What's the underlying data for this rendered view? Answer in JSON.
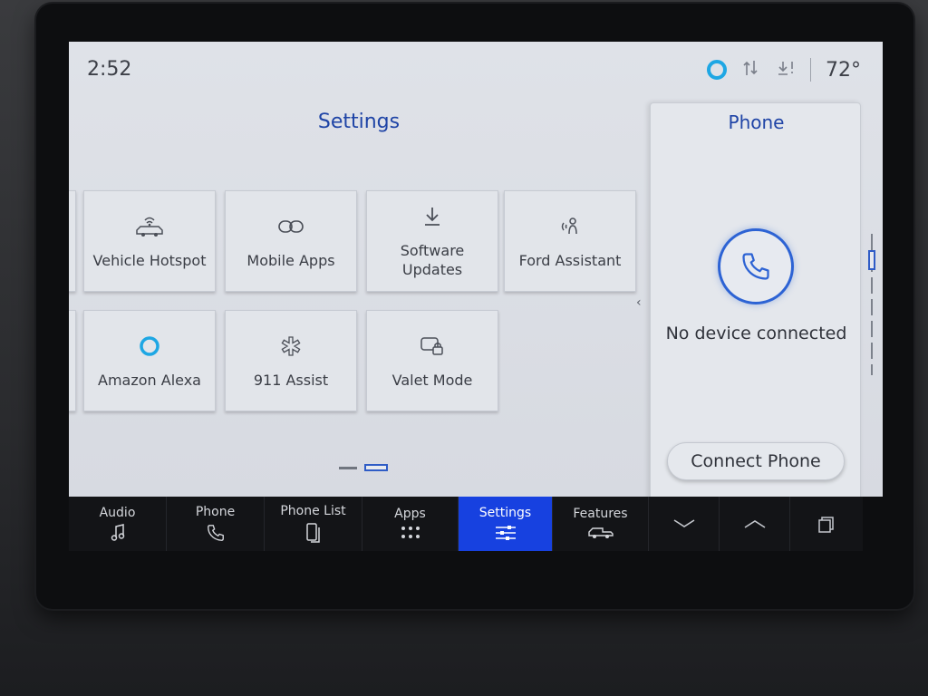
{
  "status": {
    "time": "2:52",
    "temperature": "72°",
    "alexa_color": "#1ea7e4"
  },
  "settings": {
    "title": "Settings",
    "tiles": [
      {
        "label": "Vehicle Hotspot",
        "icon": "car-wifi-icon"
      },
      {
        "label": "Mobile Apps",
        "icon": "link-icon"
      },
      {
        "label": "Software Updates",
        "icon": "download-icon"
      },
      {
        "label": "Ford Assistant",
        "icon": "voice-assistant-icon"
      },
      {
        "label": "Amazon Alexa",
        "icon": "alexa-icon"
      },
      {
        "label": "911 Assist",
        "icon": "medical-star-icon"
      },
      {
        "label": "Valet Mode",
        "icon": "valet-lock-icon"
      }
    ],
    "pager": {
      "page_count": 2,
      "active_page": 2
    }
  },
  "phone_panel": {
    "title": "Phone",
    "message": "No device connected",
    "connect_label": "Connect Phone",
    "accent": "#2d63d4"
  },
  "nav": {
    "items": [
      {
        "label": "Audio",
        "icon": "music-note-icon"
      },
      {
        "label": "Phone",
        "icon": "phone-icon"
      },
      {
        "label": "Phone List",
        "icon": "phone-list-icon"
      },
      {
        "label": "Apps",
        "icon": "apps-grid-icon"
      },
      {
        "label": "Settings",
        "icon": "sliders-icon",
        "active": true
      },
      {
        "label": "Features",
        "icon": "truck-icon"
      }
    ],
    "active_color": "#1741e0"
  }
}
